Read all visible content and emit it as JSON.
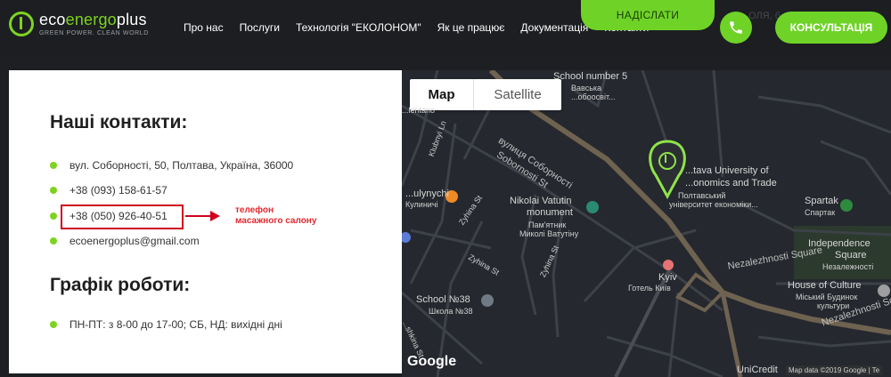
{
  "header": {
    "logo": {
      "name_prefix": "eco",
      "name_accent": "energo",
      "name_suffix": "plus",
      "tagline": "GREEN POWER. CLEAN WORLD"
    },
    "nav": [
      "Про нас",
      "Послуги",
      "Технологія \"ЕКОЛОНОМ\"",
      "Як це працює",
      "Документація",
      "Контакти"
    ],
    "send_label": "НАДІСЛАТИ",
    "consult_label": "КОНСУЛЬТАЦІЯ",
    "ghost_text": "ОЛЯ, б",
    "phone_icon": "phone-icon",
    "accent_color": "#6fd327"
  },
  "contacts": {
    "title": "Наші контакти:",
    "items": [
      "вул. Соборності, 50, Полтава, Україна, 36000",
      "+38 (093) 158-61-57",
      "+38 (050) 926-40-51",
      "ecoenergoplus@gmail.com"
    ],
    "schedule_title": "Графік роботи:",
    "schedule": "ПН-ПТ: з 8-00 до 17-00; СБ, НД: вихідні дні",
    "annotation_line1": "телефон",
    "annotation_line2": "масажного салону",
    "annotation_color": "#d0021b"
  },
  "map": {
    "tab_map": "Map",
    "tab_satellite": "Satellite",
    "labels": {
      "school5": "School number 5",
      "school5_ua1": "Вавська",
      "school5_ua2": "...обоосвіт...",
      "street_sobornosti_ua": "вулиця Соборності",
      "street_sobornosti": "Sobornosti St",
      "vatutin": "Nikolai Vatutin",
      "vatutin2": "monument",
      "vatutin_ua1": "Пам'ятник",
      "vatutin_ua2": "Миколі Ватутіну",
      "university1": "...tava University of",
      "university2": "...onomics and Trade",
      "university_ua1": "Полтавський",
      "university_ua2": "університет економіки...",
      "kulynychi": "...ulynychi",
      "kulynychi_ua": "Кулиничі",
      "spartak": "Spartak",
      "spartak_ua": "Спартак",
      "independence": "Independence",
      "independence2": "Square",
      "independence_ua": "Незалежності",
      "house_culture": "House of Culture",
      "house_culture_ua1": "Міський Будинок",
      "house_culture_ua2": "культури",
      "kyiv": "Kyiv",
      "kyiv_ua": "Готель Київ",
      "school38": "School №38",
      "school38_ua": "Школа №38",
      "nezal_sq": "Nezalezhnosti Square",
      "nezal_sq2": "Nezalezhnosti Sq.",
      "zyhina1": "Zyhina St",
      "zyhina2": "Zyhina St",
      "zyhina3": "Zyhina St",
      "shkina": "...shkina St",
      "klubnyi": "Klubnyi Ln",
      "unicredit": "UniCredit",
      "lentano": "...lentano"
    },
    "google": "Google",
    "attribution": "Map data ©2019 Google | Te"
  }
}
